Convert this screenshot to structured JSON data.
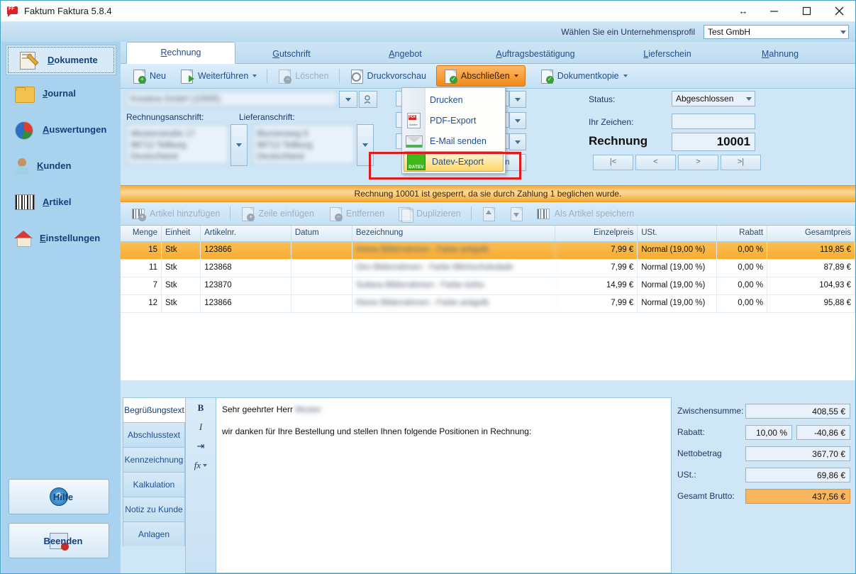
{
  "window": {
    "title": "Faktum Faktura 5.8.4",
    "app_icon": "faktum-logo-icon",
    "controls": {
      "resize": "resize-icon",
      "minimize": "minimize-icon",
      "maximize": "maximize-icon",
      "close": "close-icon"
    }
  },
  "profile": {
    "label": "Wählen Sie ein Unternehmensprofil",
    "value": "Test GmbH"
  },
  "sidebar": {
    "items": [
      {
        "label": "Dokumente",
        "accel": "D",
        "icon": "documents-icon",
        "active": true
      },
      {
        "label": "Journal",
        "accel": "J",
        "icon": "folder-icon",
        "active": false
      },
      {
        "label": "Auswertungen",
        "accel": "A",
        "icon": "pie-chart-icon",
        "active": false
      },
      {
        "label": "Kunden",
        "accel": "K",
        "icon": "user-icon",
        "active": false
      },
      {
        "label": "Artikel",
        "accel": "A",
        "icon": "barcode-icon",
        "active": false
      },
      {
        "label": "Einstellungen",
        "accel": "E",
        "icon": "house-settings-icon",
        "active": false
      }
    ],
    "help_button": "Hilfe",
    "exit_button": "Beenden"
  },
  "tabs": [
    {
      "label": "Rechnung",
      "accel": "R",
      "active": true
    },
    {
      "label": "Gutschrift",
      "accel": "G",
      "active": false
    },
    {
      "label": "Angebot",
      "accel": "A",
      "active": false
    },
    {
      "label": "Auftragsbestätigung",
      "accel": "A",
      "active": false
    },
    {
      "label": "Lieferschein",
      "accel": "L",
      "active": false
    },
    {
      "label": "Mahnung",
      "accel": "M",
      "active": false
    }
  ],
  "toolbar": {
    "neu": "Neu",
    "weiterfuehren": "Weiterführen",
    "loeschen": "Löschen",
    "druckvorschau": "Druckvorschau",
    "abschliessen": "Abschließen",
    "dokumentkopie": "Dokumentkopie"
  },
  "menu": {
    "items": [
      {
        "label": "Drucken",
        "icon": "printer-icon",
        "selected": false
      },
      {
        "label": "PDF-Export",
        "icon": "pdf-icon",
        "selected": false
      },
      {
        "label": "E-Mail senden",
        "icon": "mail-icon",
        "selected": false
      },
      {
        "label": "Datev-Export",
        "icon": "datev-icon",
        "selected": true
      }
    ]
  },
  "annotation": {
    "color": "#e01b1b",
    "target": "Datev-Export"
  },
  "form": {
    "customer": "Kreativa GmbH (10005)",
    "rechnungsanschrift_label": "Rechnungsanschrift:",
    "lieferanschrift_label": "Lieferanschrift:",
    "rechnungsanschrift": "Westenstraße 17\n98712 Tellburg\nDeutschland",
    "lieferanschrift": "Blumenweg 5\n98712 Tellburg\nDeutschland",
    "status_label": "Status:",
    "status_value": "Abgeschlossen",
    "ihr_zeichen_label": "Ihr Zeichen:",
    "ihr_zeichen_value": "",
    "doc_type": "Rechnung",
    "doc_number": "10001",
    "nav": {
      "first": "|<",
      "prev": "<",
      "next": ">",
      "last": ">|"
    },
    "hidden_button": "...onen"
  },
  "banner": {
    "text": "Rechnung 10001 ist gesperrt, da sie durch Zahlung 1 beglichen wurde."
  },
  "item_toolbar": {
    "artikel_hinzufuegen": "Artikel hinzufügen",
    "zeile_einfuegen": "Zeile einfügen",
    "entfernen": "Entfernen",
    "duplizieren": "Duplizieren",
    "move_up": "move-up-icon",
    "move_down": "move-down-icon",
    "als_artikel_speichern": "Als Artikel speichern"
  },
  "grid": {
    "columns": [
      "Menge",
      "Einheit",
      "Artikelnr.",
      "Datum",
      "Bezeichnung",
      "Einzelpreis",
      "USt.",
      "Rabatt",
      "Gesamtpreis"
    ],
    "rows": [
      {
        "menge": "15",
        "einheit": "Stk",
        "artikelnr": "123866",
        "datum": "",
        "bezeichnung": "Kleine Bilderrahmen - Farbe antigolb",
        "einzelpreis": "7,99 €",
        "ust": "Normal (19,00 %)",
        "rabatt": "0,00 %",
        "gesamtpreis": "119,85 €",
        "selected": true
      },
      {
        "menge": "11",
        "einheit": "Stk",
        "artikelnr": "123868",
        "datum": "",
        "bezeichnung": "Oiro Bilderrahmen - Farbe Milchschokolade",
        "einzelpreis": "7,99 €",
        "ust": "Normal (19,00 %)",
        "rabatt": "0,00 %",
        "gesamtpreis": "87,89 €",
        "selected": false
      },
      {
        "menge": "7",
        "einheit": "Stk",
        "artikelnr": "123870",
        "datum": "",
        "bezeichnung": "Suliana Bilderrahmen - Farbe türkis",
        "einzelpreis": "14,99 €",
        "ust": "Normal (19,00 %)",
        "rabatt": "0,00 %",
        "gesamtpreis": "104,93 €",
        "selected": false
      },
      {
        "menge": "12",
        "einheit": "Stk",
        "artikelnr": "123866",
        "datum": "",
        "bezeichnung": "Kleine Bilderrahmen - Farbe antigolb",
        "einzelpreis": "7,99 €",
        "ust": "Normal (19,00 %)",
        "rabatt": "0,00 %",
        "gesamtpreis": "95,88 €",
        "selected": false
      }
    ]
  },
  "bottom_tabs": [
    {
      "label": "Begrüßungstext",
      "active": true
    },
    {
      "label": "Abschlusstext",
      "active": false
    },
    {
      "label": "Kennzeichnung",
      "active": false
    },
    {
      "label": "Kalkulation",
      "active": false
    },
    {
      "label": "Notiz zu Kunde",
      "active": false
    },
    {
      "label": "Anlagen",
      "active": false
    }
  ],
  "editor": {
    "format_buttons": [
      "B",
      "I",
      "⇥",
      "fx"
    ],
    "line1_prefix": "Sehr geehrter Herr ",
    "line1_name": "Muster",
    "line2": "wir danken für Ihre Bestellung und stellen Ihnen folgende Positionen in Rechnung:"
  },
  "totals": {
    "rows": [
      {
        "label": "Zwischensumme:",
        "value": "408,55 €",
        "pct": null,
        "highlight": false
      },
      {
        "label": "Rabatt:",
        "value": "-40,86 €",
        "pct": "10,00 %",
        "highlight": false
      },
      {
        "label": "Nettobetrag",
        "value": "367,70 €",
        "pct": null,
        "highlight": false
      },
      {
        "label": "USt.:",
        "value": "69,86 €",
        "pct": null,
        "highlight": false
      },
      {
        "label": "Gesamt Brutto:",
        "value": "437,56 €",
        "pct": null,
        "highlight": true
      }
    ]
  },
  "colors": {
    "accent_orange": "#f08a18",
    "selection": "#f7ad33",
    "link_blue": "#1f4e90",
    "annotation_red": "#e01b1b"
  }
}
